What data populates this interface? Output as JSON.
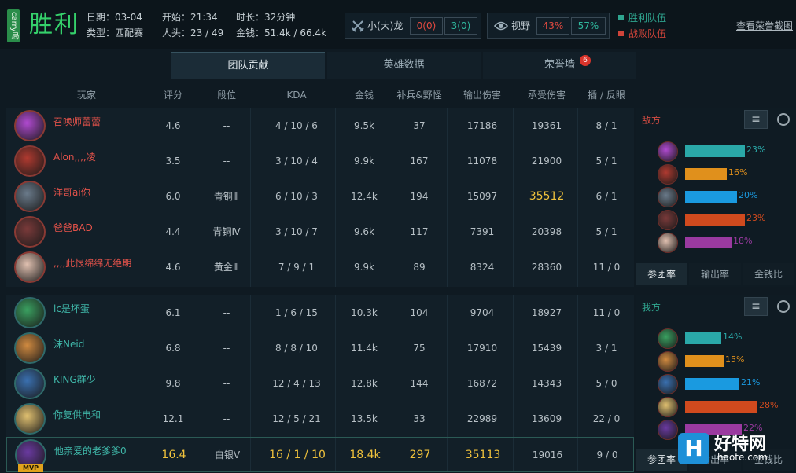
{
  "header": {
    "carry_label": "carry局",
    "result": "胜利",
    "date_label": "日期：03-04",
    "type_label": "类型：匹配赛",
    "start_label": "开始：21:34",
    "kills_label": "人头：23 / 49",
    "duration_label": "时长：32分钟",
    "gold_label": "金钱：51.4k / 66.4k",
    "dragon_label": "小(大)龙",
    "dragon_a": "0(0)",
    "dragon_b": "3(0)",
    "vision_label": "视野",
    "vision_a": "43%",
    "vision_b": "57%",
    "legend_win": "胜利队伍",
    "legend_lose": "战败队伍",
    "honor_link": "查看荣誉截图"
  },
  "tabs": [
    {
      "label": "团队贡献"
    },
    {
      "label": "英雄数据"
    },
    {
      "label": "荣誉墙",
      "badge": "6"
    }
  ],
  "columns": [
    "玩家",
    "评分",
    "段位",
    "KDA",
    "金钱",
    "补兵&野怪",
    "输出伤害",
    "承受伤害",
    "插 / 反眼"
  ],
  "enemy_team": [
    {
      "name": "召唤师蕾蕾",
      "score": "4.6",
      "rank": "--",
      "kda": "4 / 10 / 6",
      "gold": "9.5k",
      "cs": "37",
      "dmg": "17186",
      "taken": "19361",
      "ward": "8 / 1"
    },
    {
      "name": "Alon,,,,凌",
      "score": "3.5",
      "rank": "--",
      "kda": "3 / 10 / 4",
      "gold": "9.9k",
      "cs": "167",
      "dmg": "11078",
      "taken": "21900",
      "ward": "5 / 1"
    },
    {
      "name": "洋哥ai你",
      "score": "6.0",
      "rank": "青铜Ⅲ",
      "kda": "6 / 10 / 3",
      "gold": "12.4k",
      "cs": "194",
      "dmg": "15097",
      "taken": "35512",
      "ward": "6 / 1"
    },
    {
      "name": "爸爸BAD",
      "score": "4.4",
      "rank": "青铜Ⅳ",
      "kda": "3 / 10 / 7",
      "gold": "9.6k",
      "cs": "117",
      "dmg": "7391",
      "taken": "20398",
      "ward": "5 / 1"
    },
    {
      "name": ",,,,此恨绵绵无绝期",
      "score": "4.6",
      "rank": "黄金Ⅲ",
      "kda": "7 / 9 / 1",
      "gold": "9.9k",
      "cs": "89",
      "dmg": "8324",
      "taken": "28360",
      "ward": "11 / 0"
    }
  ],
  "my_team": [
    {
      "name": "lc是坏蛋",
      "score": "6.1",
      "rank": "--",
      "kda": "1 / 6 / 15",
      "gold": "10.3k",
      "cs": "104",
      "dmg": "9704",
      "taken": "18927",
      "ward": "11 / 0"
    },
    {
      "name": "沫Neid",
      "score": "6.8",
      "rank": "--",
      "kda": "8 / 8 / 10",
      "gold": "11.4k",
      "cs": "75",
      "dmg": "17910",
      "taken": "15439",
      "ward": "3 / 1"
    },
    {
      "name": "KING群少",
      "score": "9.8",
      "rank": "--",
      "kda": "12 / 4 / 13",
      "gold": "12.8k",
      "cs": "144",
      "dmg": "16872",
      "taken": "14343",
      "ward": "5 / 0"
    },
    {
      "name": "你复供电和",
      "score": "12.1",
      "rank": "--",
      "kda": "12 / 5 / 21",
      "gold": "13.5k",
      "cs": "33",
      "dmg": "22989",
      "taken": "13609",
      "ward": "22 / 0"
    },
    {
      "name": "他亲爱的老爹爹0",
      "score": "16.4",
      "rank": "白银Ⅴ",
      "kda": "16 / 1 / 10",
      "gold": "18.4k",
      "cs": "297",
      "dmg": "35113",
      "taken": "19016",
      "ward": "9 / 0",
      "mvp": "MVP"
    }
  ],
  "enemy_side": {
    "title": "敌方",
    "bars": [
      {
        "pct": "23%",
        "value": 23,
        "color": "#2aa8a8"
      },
      {
        "pct": "16%",
        "value": 16,
        "color": "#e0901c"
      },
      {
        "pct": "20%",
        "value": 20,
        "color": "#1a9ae0"
      },
      {
        "pct": "23%",
        "value": 23,
        "color": "#d04a1e"
      },
      {
        "pct": "18%",
        "value": 18,
        "color": "#9a3aa0"
      }
    ],
    "tabs": [
      "参团率",
      "输出率",
      "金钱比"
    ]
  },
  "my_side": {
    "title": "我方",
    "bars": [
      {
        "pct": "14%",
        "value": 14,
        "color": "#2aa8a8"
      },
      {
        "pct": "15%",
        "value": 15,
        "color": "#e0901c"
      },
      {
        "pct": "21%",
        "value": 21,
        "color": "#1a9ae0"
      },
      {
        "pct": "28%",
        "value": 28,
        "color": "#d04a1e"
      },
      {
        "pct": "22%",
        "value": 22,
        "color": "#9a3aa0"
      }
    ],
    "tabs": [
      "参团率",
      "输出率",
      "金钱比"
    ]
  },
  "watermark": {
    "title": "好特网",
    "sub": "haote.com"
  },
  "colors": {
    "win": "#2fa58f",
    "lose": "#d0443a",
    "accent_gold": "#f0c23c"
  }
}
